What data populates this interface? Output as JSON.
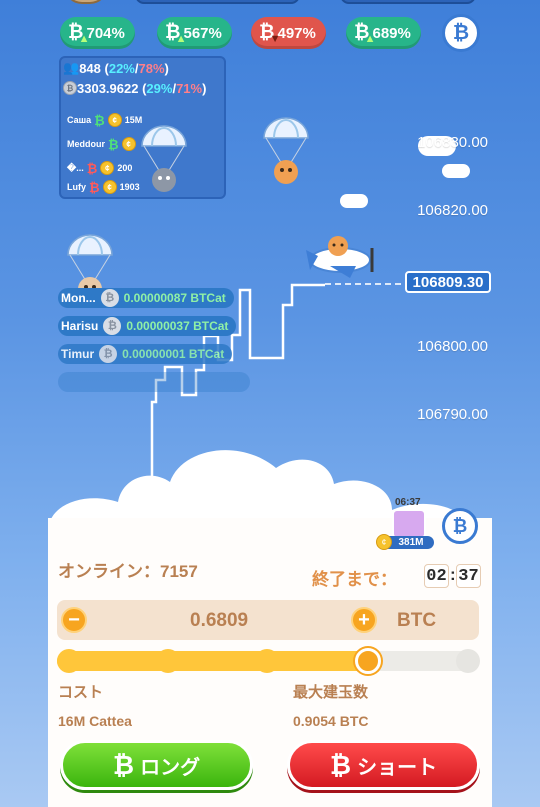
{
  "top_chips": [
    {
      "value": "704%",
      "trend": "up"
    },
    {
      "value": "567%",
      "trend": "up"
    },
    {
      "value": "497%",
      "trend": "down"
    },
    {
      "value": "689%",
      "trend": "up"
    }
  ],
  "info_panel": {
    "players": "848",
    "players_long_pct": "22%",
    "players_short_pct": "78%",
    "coins": "3303.9622",
    "coins_long_pct": "29%",
    "coins_short_pct": "71%",
    "leaders": [
      {
        "name": "Саша",
        "direction": "up",
        "amount": "15M"
      },
      {
        "name": "Meddour",
        "direction": "up",
        "amount": ""
      },
      {
        "name": "�...",
        "direction": "down",
        "amount": "200"
      },
      {
        "name": "Lufy",
        "direction": "down",
        "amount": "1903"
      }
    ]
  },
  "price_axis": {
    "ticks": [
      "106830.00",
      "106820.00",
      "106800.00",
      "106790.00"
    ],
    "current": "106809.30"
  },
  "feed": [
    {
      "name": "Mon...",
      "amount": "0.00000087 BTCat"
    },
    {
      "name": "Harisu",
      "amount": "0.00000037 BTCat"
    },
    {
      "name": "Timur",
      "amount": "0.00000001 BTCat"
    }
  ],
  "chest": {
    "timer": "06:37",
    "badge": "381M"
  },
  "online": {
    "label": "オンライン：",
    "count": "7157"
  },
  "countdown": {
    "label": "終了まで：",
    "minutes": "02",
    "seconds": "37"
  },
  "bet": {
    "amount": "0.6809",
    "unit": "BTC",
    "minus": "−",
    "plus": "+"
  },
  "slider": {
    "value_fraction": 0.75
  },
  "cost": {
    "label": "コスト",
    "value": "16M Cattea"
  },
  "max_position": {
    "label": "最大建玉数",
    "value": "0.9054 BTC"
  },
  "buttons": {
    "long": "ロング",
    "short": "ショート"
  },
  "icons": {
    "btc": "₿",
    "tick": "↑",
    "down": "↓"
  },
  "colors": {
    "long": "#3bb50e",
    "short": "#d41a22",
    "accent": "#f7a520",
    "sky": "#5b95e3"
  }
}
